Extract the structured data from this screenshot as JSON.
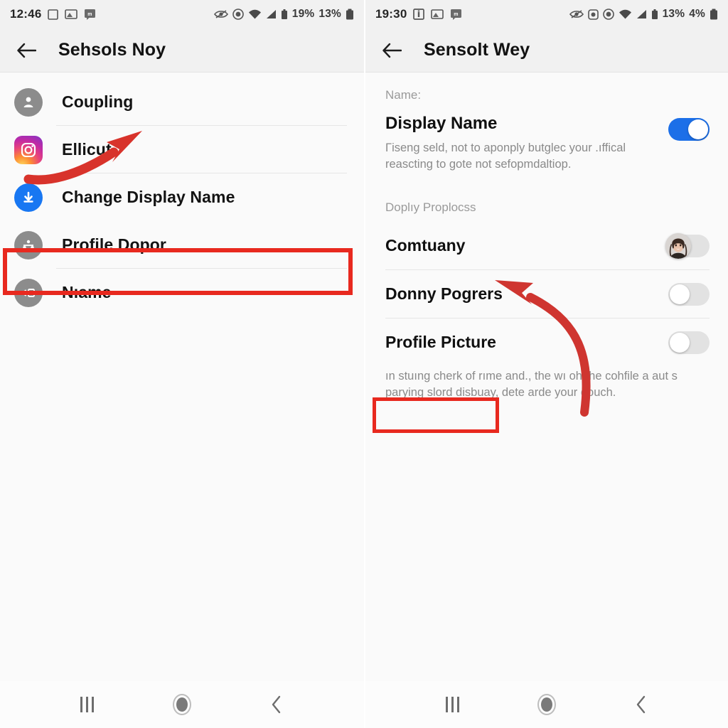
{
  "left": {
    "statusbar": {
      "time": "12:46",
      "left_icons": [
        "square-outline-icon",
        "image-icon",
        "message-badge-icon"
      ],
      "right_icons": [
        "eye-slash-icon",
        "shield-icon",
        "wifi-icon",
        "signal-icon",
        "sim-icon"
      ],
      "data_percent": "19%",
      "battery_percent": "13%",
      "battery_icon": "battery-icon"
    },
    "appbar": {
      "back_icon": "back-arrow-icon",
      "title": "Sehsols Noy"
    },
    "rows": [
      {
        "label": "Coupling",
        "icon": "person-avatar-icon"
      },
      {
        "label": "Ellicut",
        "icon": "instagram-icon"
      },
      {
        "label": "Change Display Name",
        "icon": "download-circle-icon"
      },
      {
        "label": "Profile Dopor",
        "icon": "share-nodes-icon"
      },
      {
        "label": "Nıame",
        "icon": "logout-icon"
      }
    ],
    "highlight": {
      "target": "Change Display Name",
      "color": "#e8291f"
    },
    "annotation_arrow": {
      "points_to": "Change Display Name",
      "color": "#dc3226"
    },
    "navbar": {
      "recent_icon": "recent-apps-icon",
      "home_icon": "home-icon",
      "back_icon": "nav-back-icon"
    }
  },
  "right": {
    "statusbar": {
      "time": "19:30",
      "left_icons": [
        "info-box-icon",
        "image-icon",
        "message-badge-icon"
      ],
      "right_icons": [
        "eye-slash-icon",
        "badge-icon",
        "shield-icon",
        "wifi-icon",
        "signal-icon",
        "sim-icon"
      ],
      "data_percent": "13%",
      "battery_percent": "4%",
      "battery_icon": "battery-icon"
    },
    "appbar": {
      "back_icon": "back-arrow-icon",
      "title": "Sensolt Wey"
    },
    "section_one_label": "Name:",
    "display_name": {
      "title": "Display Name",
      "description": "Γiseng seld, not to aponply butglec your .ıffical reascting to gote not sefopmdaltiop.",
      "toggle_on": true
    },
    "section_two_label": "Doplıy Proplocss",
    "rows": [
      {
        "label": "Comtuany",
        "toggle_on": false,
        "thumb": "photo-avatar-icon"
      },
      {
        "label": "Donny Pogrers",
        "toggle_on": false,
        "thumb": "plain-knob"
      },
      {
        "label": "Profile Picture",
        "toggle_on": false,
        "thumb": "plain-knob"
      }
    ],
    "footer_note": "ın stuıng cherk of rıme and., the wı oh the cohfile a aut s parying slord disbuay, dete arde your douch.",
    "highlight": {
      "target": "Profile Picture",
      "color": "#e8291f"
    },
    "annotation_arrow": {
      "points_to": "Donny Pogrers",
      "color": "#cf3530"
    },
    "navbar": {
      "recent_icon": "recent-apps-icon",
      "home_icon": "home-icon",
      "back_icon": "nav-back-icon"
    }
  },
  "colors": {
    "accent_blue": "#1c6fe8",
    "highlight_red": "#e8291f",
    "arrow_red": "#d8332b",
    "bg": "#fafafa",
    "bar_bg": "#f1f1f1"
  }
}
